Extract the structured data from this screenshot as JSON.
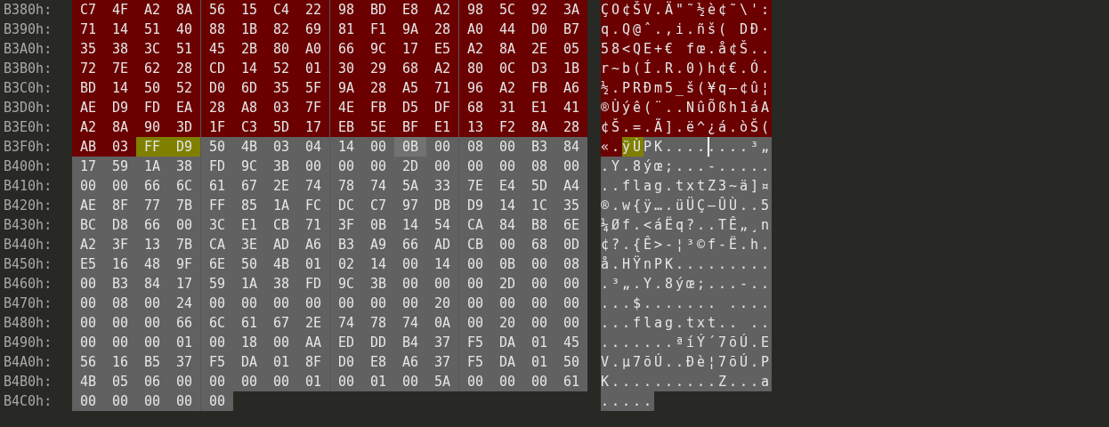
{
  "rows": [
    {
      "offset": "B380h:",
      "segments": [
        {
          "kind": "selection",
          "bytes": [
            "C7",
            "4F",
            "A2",
            "8A",
            "56",
            "15",
            "C4",
            "22",
            "98",
            "BD",
            "E8",
            "A2",
            "98",
            "5C",
            "92",
            "3A"
          ],
          "ascii": "ÇO¢ŠV.Ä\"˜½è¢˜\\':"
        }
      ]
    },
    {
      "offset": "B390h:",
      "segments": [
        {
          "kind": "selection",
          "bytes": [
            "71",
            "14",
            "51",
            "40",
            "88",
            "1B",
            "82",
            "69",
            "81",
            "F1",
            "9A",
            "28",
            "A0",
            "44",
            "D0",
            "B7"
          ],
          "ascii": "q.Q@ˆ.‚i.ñš( DÐ·"
        }
      ]
    },
    {
      "offset": "B3A0h:",
      "segments": [
        {
          "kind": "selection",
          "bytes": [
            "35",
            "38",
            "3C",
            "51",
            "45",
            "2B",
            "80",
            "A0",
            "66",
            "9C",
            "17",
            "E5",
            "A2",
            "8A",
            "2E",
            "05"
          ],
          "ascii": "58<QE+€ fœ.å¢Š.."
        }
      ]
    },
    {
      "offset": "B3B0h:",
      "segments": [
        {
          "kind": "selection",
          "bytes": [
            "72",
            "7E",
            "62",
            "28",
            "CD",
            "14",
            "52",
            "01",
            "30",
            "29",
            "68",
            "A2",
            "80",
            "0C",
            "D3",
            "1B"
          ],
          "ascii": "r~b(Í.R.0)h¢€.Ó."
        }
      ]
    },
    {
      "offset": "B3C0h:",
      "segments": [
        {
          "kind": "selection",
          "bytes": [
            "BD",
            "14",
            "50",
            "52",
            "D0",
            "6D",
            "35",
            "5F",
            "9A",
            "28",
            "A5",
            "71",
            "96",
            "A2",
            "FB",
            "A6"
          ],
          "ascii": "½.PRÐm5_š(¥q–¢û¦"
        }
      ]
    },
    {
      "offset": "B3D0h:",
      "segments": [
        {
          "kind": "selection",
          "bytes": [
            "AE",
            "D9",
            "FD",
            "EA",
            "28",
            "A8",
            "03",
            "7F",
            "4E",
            "FB",
            "D5",
            "DF",
            "68",
            "31",
            "E1",
            "41"
          ],
          "ascii": "®Ùýê(¨..NûÕßh1áA"
        }
      ]
    },
    {
      "offset": "B3E0h:",
      "segments": [
        {
          "kind": "selection",
          "bytes": [
            "A2",
            "8A",
            "90",
            "3D",
            "1F",
            "C3",
            "5D",
            "17",
            "EB",
            "5E",
            "BF",
            "E1",
            "13",
            "F2",
            "8A",
            "28"
          ],
          "ascii": "¢Š.=.Ã].ë^¿á.òŠ("
        }
      ]
    },
    {
      "offset": "B3F0h:",
      "segments": [
        {
          "kind": "selection",
          "bytes": [
            "AB",
            "03"
          ],
          "ascii": "«."
        },
        {
          "kind": "highlight",
          "bytes": [
            "FF",
            "D9"
          ],
          "ascii": "ÿÙ"
        },
        {
          "kind": "plain",
          "bytes": [
            "50",
            "4B",
            "03",
            "04",
            "14",
            "00"
          ],
          "ascii": "PK...."
        },
        {
          "kind": "cursor",
          "bytes": [
            "0B"
          ],
          "ascii": "."
        },
        {
          "kind": "plain",
          "bytes": [
            "00",
            "08",
            "00",
            "B3",
            "84"
          ],
          "ascii": "...³„"
        }
      ]
    },
    {
      "offset": "B400h:",
      "segments": [
        {
          "kind": "plain",
          "bytes": [
            "17",
            "59",
            "1A",
            "38",
            "FD",
            "9C",
            "3B",
            "00",
            "00",
            "00",
            "2D",
            "00",
            "00",
            "00",
            "08",
            "00"
          ],
          "ascii": ".Y.8ýœ;...-....."
        }
      ]
    },
    {
      "offset": "B410h:",
      "segments": [
        {
          "kind": "plain",
          "bytes": [
            "00",
            "00",
            "66",
            "6C",
            "61",
            "67",
            "2E",
            "74",
            "78",
            "74",
            "5A",
            "33",
            "7E",
            "E4",
            "5D",
            "A4"
          ],
          "ascii": "..flag.txtZ3~ä]¤"
        }
      ]
    },
    {
      "offset": "B420h:",
      "segments": [
        {
          "kind": "plain",
          "bytes": [
            "AE",
            "8F",
            "77",
            "7B",
            "FF",
            "85",
            "1A",
            "FC",
            "DC",
            "C7",
            "97",
            "DB",
            "D9",
            "14",
            "1C",
            "35"
          ],
          "ascii": "®.w{ÿ….üÜÇ—ÛÙ..5"
        }
      ]
    },
    {
      "offset": "B430h:",
      "segments": [
        {
          "kind": "plain",
          "bytes": [
            "BC",
            "D8",
            "66",
            "00",
            "3C",
            "E1",
            "CB",
            "71",
            "3F",
            "0B",
            "14",
            "54",
            "CA",
            "84",
            "B8",
            "6E"
          ],
          "ascii": "¼Øf.<áËq?..TÊ„¸n"
        }
      ]
    },
    {
      "offset": "B440h:",
      "segments": [
        {
          "kind": "plain",
          "bytes": [
            "A2",
            "3F",
            "13",
            "7B",
            "CA",
            "3E",
            "AD",
            "A6",
            "B3",
            "A9",
            "66",
            "AD",
            "CB",
            "00",
            "68",
            "0D"
          ],
          "ascii": "¢?.{Ê>-¦³©f-Ë.h."
        }
      ]
    },
    {
      "offset": "B450h:",
      "segments": [
        {
          "kind": "plain",
          "bytes": [
            "E5",
            "16",
            "48",
            "9F",
            "6E",
            "50",
            "4B",
            "01",
            "02",
            "14",
            "00",
            "14",
            "00",
            "0B",
            "00",
            "08"
          ],
          "ascii": "å.HŸnPK........."
        }
      ]
    },
    {
      "offset": "B460h:",
      "segments": [
        {
          "kind": "plain",
          "bytes": [
            "00",
            "B3",
            "84",
            "17",
            "59",
            "1A",
            "38",
            "FD",
            "9C",
            "3B",
            "00",
            "00",
            "00",
            "2D",
            "00",
            "00"
          ],
          "ascii": ".³„.Y.8ýœ;...-.."
        }
      ]
    },
    {
      "offset": "B470h:",
      "segments": [
        {
          "kind": "plain",
          "bytes": [
            "00",
            "08",
            "00",
            "24",
            "00",
            "00",
            "00",
            "00",
            "00",
            "00",
            "00",
            "20",
            "00",
            "00",
            "00",
            "00"
          ],
          "ascii": "...$....... ...."
        }
      ]
    },
    {
      "offset": "B480h:",
      "segments": [
        {
          "kind": "plain",
          "bytes": [
            "00",
            "00",
            "00",
            "66",
            "6C",
            "61",
            "67",
            "2E",
            "74",
            "78",
            "74",
            "0A",
            "00",
            "20",
            "00",
            "00"
          ],
          "ascii": "...flag.txt.. .."
        }
      ]
    },
    {
      "offset": "B490h:",
      "segments": [
        {
          "kind": "plain",
          "bytes": [
            "00",
            "00",
            "00",
            "01",
            "00",
            "18",
            "00",
            "AA",
            "ED",
            "DD",
            "B4",
            "37",
            "F5",
            "DA",
            "01",
            "45"
          ],
          "ascii": ".......ªíÝ´7õÚ.E"
        }
      ]
    },
    {
      "offset": "B4A0h:",
      "segments": [
        {
          "kind": "plain",
          "bytes": [
            "56",
            "16",
            "B5",
            "37",
            "F5",
            "DA",
            "01",
            "8F",
            "D0",
            "E8",
            "A6",
            "37",
            "F5",
            "DA",
            "01",
            "50"
          ],
          "ascii": "V.µ7õÚ..Ðè¦7õÚ.P"
        }
      ]
    },
    {
      "offset": "B4B0h:",
      "segments": [
        {
          "kind": "plain",
          "bytes": [
            "4B",
            "05",
            "06",
            "00",
            "00",
            "00",
            "00",
            "01",
            "00",
            "01",
            "00",
            "5A",
            "00",
            "00",
            "00",
            "61"
          ],
          "ascii": "K..........Z...a"
        }
      ]
    },
    {
      "offset": "B4C0h:",
      "segments": [
        {
          "kind": "plain",
          "bytes": [
            "00",
            "00",
            "00",
            "00",
            "00"
          ],
          "ascii": "....."
        }
      ]
    }
  ]
}
